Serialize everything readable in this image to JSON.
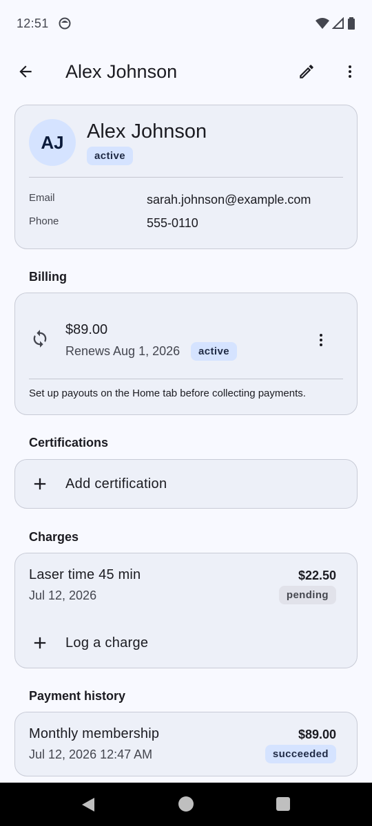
{
  "status_bar": {
    "time": "12:51"
  },
  "app_bar": {
    "title": "Alex Johnson"
  },
  "profile": {
    "initials": "AJ",
    "name": "Alex Johnson",
    "status": "active",
    "email_label": "Email",
    "email": "sarah.johnson@example.com",
    "phone_label": "Phone",
    "phone": "555-0110"
  },
  "billing": {
    "section_title": "Billing",
    "amount": "$89.00",
    "renews": "Renews Aug 1, 2026",
    "status": "active",
    "note": "Set up payouts on the Home tab before collecting payments."
  },
  "certifications": {
    "section_title": "Certifications",
    "add_label": "Add certification"
  },
  "charges": {
    "section_title": "Charges",
    "items": [
      {
        "title": "Laser time 45 min",
        "date": "Jul 12, 2026",
        "amount": "$22.50",
        "status": "pending"
      }
    ],
    "log_label": "Log a charge"
  },
  "payment_history": {
    "section_title": "Payment history",
    "items": [
      {
        "title": "Monthly membership",
        "date": "Jul 12, 2026 12:47 AM",
        "amount": "$89.00",
        "status": "succeeded"
      }
    ]
  },
  "colors": {
    "accent_container": "#d5e3ff",
    "card_background": "#edf0f8",
    "page_background": "#f8f9ff"
  },
  "icons": [
    "back-arrow-icon",
    "edit-pencil-icon",
    "more-vert-icon",
    "sync-icon",
    "plus-icon"
  ]
}
